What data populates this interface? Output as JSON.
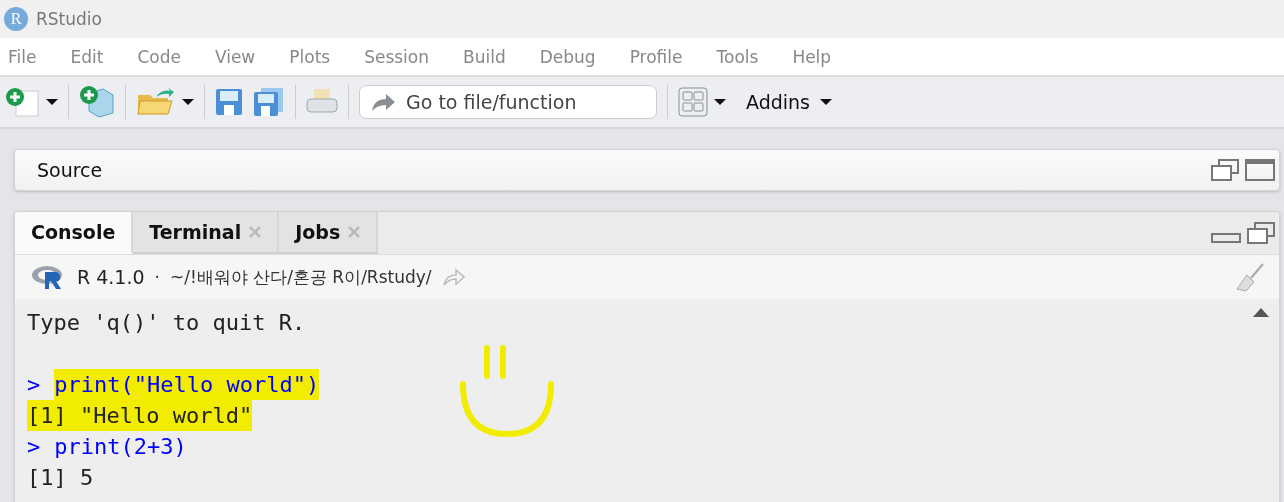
{
  "window": {
    "title": "RStudio",
    "logo": "R"
  },
  "menu": [
    "File",
    "Edit",
    "Code",
    "View",
    "Plots",
    "Session",
    "Build",
    "Debug",
    "Profile",
    "Tools",
    "Help"
  ],
  "toolbar": {
    "goto_placeholder": "Go to file/function",
    "addins": "Addins"
  },
  "source_pane": {
    "title": "Source"
  },
  "console_pane": {
    "tabs": [
      {
        "label": "Console",
        "selected": true,
        "closable": false
      },
      {
        "label": "Terminal",
        "selected": false,
        "closable": true
      },
      {
        "label": "Jobs",
        "selected": false,
        "closable": true
      }
    ],
    "version": "R 4.1.0",
    "separator": "·",
    "path": "~/!배워야 산다/혼공 R이/Rstudy/",
    "lines": [
      {
        "kind": "output",
        "text": "Type 'q()' to quit R.",
        "highlighted": false
      },
      {
        "kind": "blank"
      },
      {
        "kind": "prompt",
        "prompt": ">",
        "text": "print(\"Hello world\")",
        "highlighted": true
      },
      {
        "kind": "output",
        "text": "[1] \"Hello world\"",
        "highlighted": true
      },
      {
        "kind": "prompt",
        "prompt": ">",
        "text": "print(2+3)",
        "highlighted": false
      },
      {
        "kind": "output",
        "text": "[1] 5",
        "highlighted": false
      }
    ]
  }
}
